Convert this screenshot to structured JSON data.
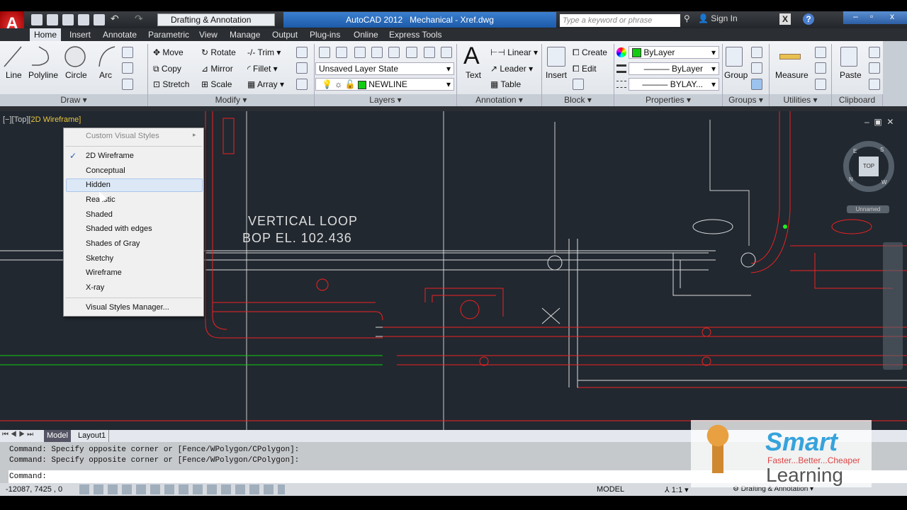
{
  "title_bar": {
    "app_title": "AutoCAD 2012",
    "file_title": "Mechanical - Xref.dwg",
    "workspace": "Drafting & Annotation",
    "search_placeholder": "Type a keyword or phrase",
    "sign_in": "Sign In"
  },
  "tabs": [
    "Home",
    "Insert",
    "Annotate",
    "Parametric",
    "View",
    "Manage",
    "Output",
    "Plug-ins",
    "Online",
    "Express Tools"
  ],
  "ribbon": {
    "draw": {
      "label": "Draw",
      "tools": [
        "Line",
        "Polyline",
        "Circle",
        "Arc"
      ]
    },
    "modify": {
      "label": "Modify",
      "tools": [
        "Move",
        "Rotate",
        "Trim",
        "Copy",
        "Mirror",
        "Fillet",
        "Stretch",
        "Scale",
        "Array"
      ]
    },
    "layers": {
      "label": "Layers",
      "layer_state": "Unsaved Layer State",
      "current_layer": "NEWLINE"
    },
    "annotation": {
      "label": "Annotation",
      "text": "Text",
      "linear": "Linear",
      "leader": "Leader",
      "table": "Table"
    },
    "block": {
      "label": "Block",
      "insert": "Insert",
      "create": "Create",
      "edit": "Edit"
    },
    "properties": {
      "label": "Properties",
      "color": "ByLayer",
      "lineweight": "ByLayer",
      "linetype": "BYLAY..."
    },
    "groups": {
      "label": "Groups",
      "group": "Group"
    },
    "utilities": {
      "label": "Utilities",
      "measure": "Measure"
    },
    "clipboard": {
      "label": "Clipboard",
      "paste": "Paste"
    }
  },
  "viewport": {
    "minus": "[−]",
    "view": "[Top]",
    "style": "[2D Wireframe]",
    "viewcube": "TOP",
    "compass": {
      "n": "N",
      "s": "S",
      "w": "W",
      "e": "E"
    },
    "ucs": "Unnamed"
  },
  "drawing_text": [
    "VERTICAL LOOP",
    "BOP EL. 102.436"
  ],
  "context_menu": {
    "header": "Custom Visual Styles",
    "items": [
      "2D Wireframe",
      "Conceptual",
      "Hidden",
      "Realistic",
      "Shaded",
      "Shaded with edges",
      "Shades of Gray",
      "Sketchy",
      "Wireframe",
      "X-ray"
    ],
    "checked": "2D Wireframe",
    "highlighted": "Hidden",
    "footer": "Visual Styles Manager..."
  },
  "layout_tabs": [
    "Model",
    "Layout1"
  ],
  "command_history": [
    "Command: Specify opposite corner or [Fence/WPolygon/CPolygon]:",
    "Command: Specify opposite corner or [Fence/WPolygon/CPolygon]:"
  ],
  "command_prompt": "Command:",
  "status_bar": {
    "coords": "-12087, 7425 , 0",
    "model": "MODEL",
    "scale": "1:1",
    "workspace": "Drafting & Annotation"
  },
  "watermark": {
    "brand": "Smart",
    "tagline": "Faster...Better...Cheaper",
    "sub": "Learning"
  }
}
